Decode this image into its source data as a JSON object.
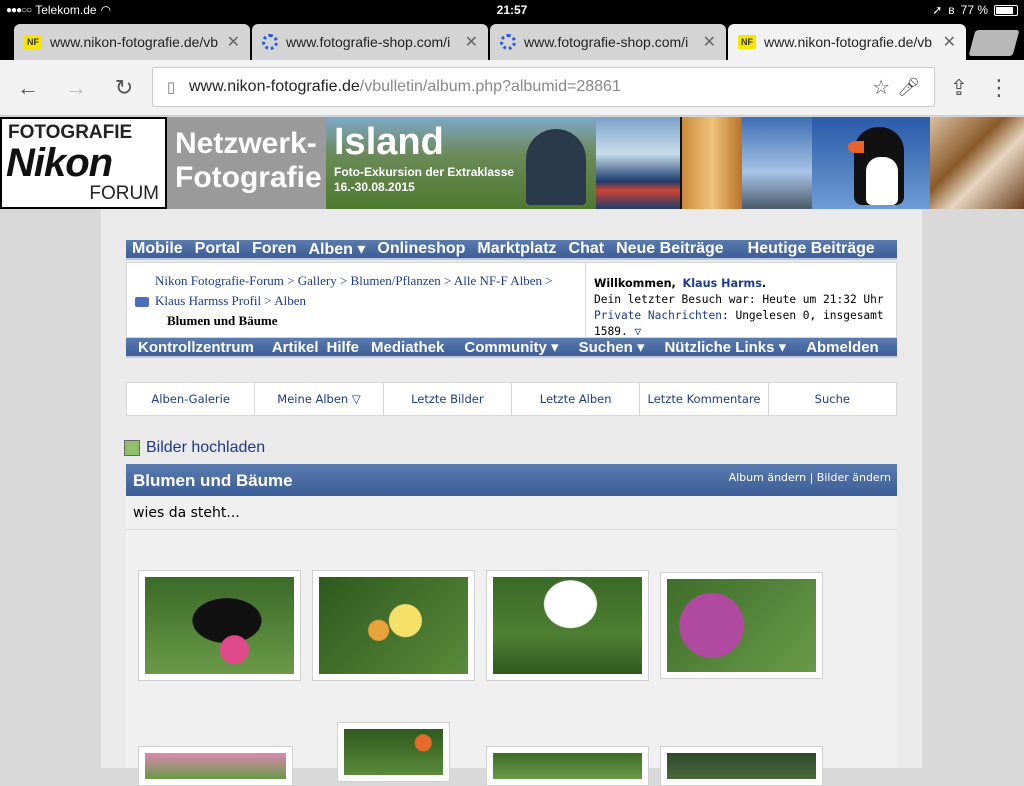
{
  "status": {
    "carrier": "Telekom.de",
    "time": "21:57",
    "battery": "77 %",
    "battery_level": 0.77
  },
  "tabs": [
    {
      "title": "www.nikon-fotografie.de/vb",
      "favicon": "NF",
      "active": false
    },
    {
      "title": "www.fotografie-shop.com/i",
      "favicon": "",
      "active": false
    },
    {
      "title": "www.fotografie-shop.com/i",
      "favicon": "",
      "active": false
    },
    {
      "title": "www.nikon-fotografie.de/vb",
      "favicon": "NF",
      "active": true
    }
  ],
  "address": {
    "host": "www.nikon-fotografie.de",
    "path": "/vbulletin/album.php?albumid=28861"
  },
  "banner": {
    "logo_top": "FOTOGRAFIE",
    "logo_main": "Nikon",
    "logo_bottom": "FORUM",
    "netz1": "Netzwerk-",
    "netz2": "Fotografie",
    "island_title": "Island",
    "island_sub1": "Foto-Exkursion der Extraklasse",
    "island_sub2": "16.-30.08.2015"
  },
  "nav1": [
    "Mobile",
    "Portal",
    "Foren",
    "Alben ▾",
    "Onlineshop",
    "Marktplatz",
    "Chat",
    "Neue Beiträge",
    "Heutige Beiträge"
  ],
  "crumbs": {
    "line1": "Nikon Fotografie-Forum > Gallery > Blumen/Pflanzen > Alle NF-F Alben >",
    "line2": "Klaus Harmss Profil > Alben",
    "current": "Blumen und Bäume"
  },
  "welcome": {
    "greet": "Willkommen,",
    "user": "Klaus Harms",
    "last_visit": "Dein letzter Besuch war: Heute um 21:32 Uhr",
    "pm_label": "Private Nachrichten",
    "pm_text": ": Ungelesen 0, insgesamt 1589."
  },
  "nav2": [
    "Kontrollzentrum",
    "Artikel",
    "Hilfe",
    "Mediathek",
    "Community ▾",
    "Suchen ▾",
    "Nützliche Links ▾",
    "Abmelden"
  ],
  "album_tabs": [
    "Alben-Galerie",
    "Meine Alben ▽",
    "Letzte Bilder",
    "Letzte Alben",
    "Letzte Kommentare",
    "Suche"
  ],
  "upload": "Bilder hochladen",
  "album": {
    "title": "Blumen und Bäume",
    "links": "Album ändern | Bilder ändern",
    "description": "wies da steht..."
  },
  "colors": {
    "nav_blue": "#3d5e96",
    "link_blue": "#1d3a8a"
  }
}
